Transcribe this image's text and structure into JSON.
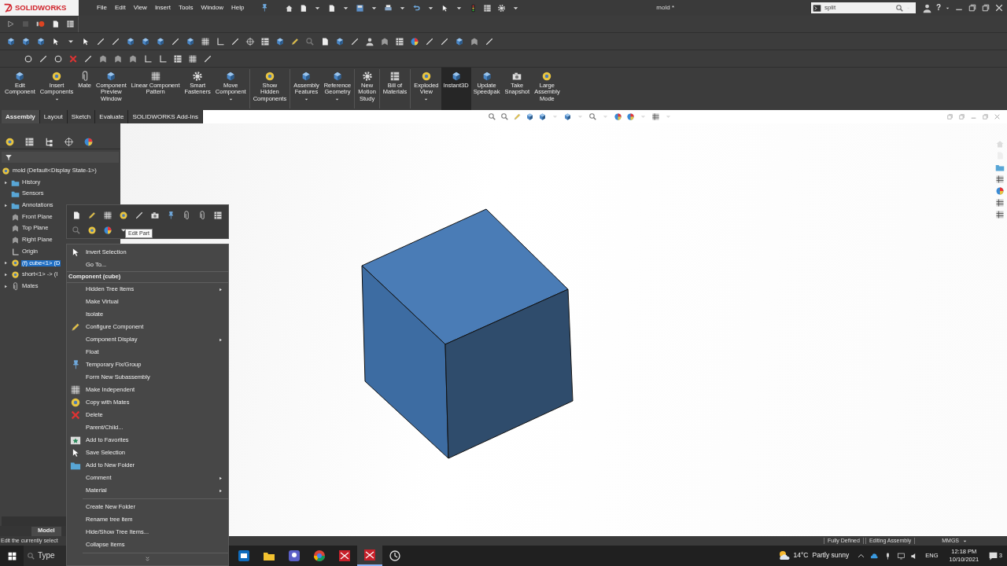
{
  "title_bar": {
    "logo": "SOLIDWORKS",
    "menus": [
      "File",
      "Edit",
      "View",
      "Insert",
      "Tools",
      "Window",
      "Help"
    ],
    "document_title": "mold *",
    "search": {
      "value": "split"
    },
    "help": "?"
  },
  "command_manager": {
    "buttons": [
      {
        "label": "Edit\nComponent",
        "dropdown": false,
        "selected": false
      },
      {
        "label": "Insert\nComponents",
        "dropdown": true,
        "selected": false
      },
      {
        "label": "Mate",
        "dropdown": false,
        "selected": false
      },
      {
        "label": "Component\nPreview\nWindow",
        "dropdown": false,
        "selected": false
      },
      {
        "label": "Linear Component\nPattern",
        "dropdown": false,
        "selected": false
      },
      {
        "label": "Smart\nFasteners",
        "dropdown": false,
        "selected": false
      },
      {
        "label": "Move\nComponent",
        "dropdown": true,
        "selected": false
      },
      {
        "label": "Show\nHidden\nComponents",
        "dropdown": false,
        "selected": false
      },
      {
        "label": "Assembly\nFeatures",
        "dropdown": true,
        "selected": false
      },
      {
        "label": "Reference\nGeometry",
        "dropdown": true,
        "selected": false
      },
      {
        "label": "New\nMotion\nStudy",
        "dropdown": false,
        "selected": false
      },
      {
        "label": "Bill of\nMaterials",
        "dropdown": false,
        "selected": false
      },
      {
        "label": "Exploded\nView",
        "dropdown": true,
        "selected": false
      },
      {
        "label": "Instant3D",
        "dropdown": false,
        "selected": true
      },
      {
        "label": "Update\nSpeedpak",
        "dropdown": false,
        "selected": false
      },
      {
        "label": "Take\nSnapshot",
        "dropdown": false,
        "selected": false
      },
      {
        "label": "Large\nAssembly\nMode",
        "dropdown": false,
        "selected": false
      }
    ],
    "tabs": [
      {
        "label": "Assembly",
        "selected": true
      },
      {
        "label": "Layout",
        "selected": false
      },
      {
        "label": "Sketch",
        "selected": false
      },
      {
        "label": "Evaluate",
        "selected": false
      },
      {
        "label": "SOLIDWORKS Add-Ins",
        "selected": false
      }
    ]
  },
  "feature_tree": {
    "root": "mold  (Default<Display State-1>)",
    "items": [
      {
        "label": "History",
        "kind": "folder",
        "expandable": true,
        "selected": false
      },
      {
        "label": "Sensors",
        "kind": "folder",
        "expandable": false,
        "selected": false
      },
      {
        "label": "Annotations",
        "kind": "folder",
        "expandable": true,
        "selected": false
      },
      {
        "label": "Front Plane",
        "kind": "plane",
        "expandable": false,
        "selected": false
      },
      {
        "label": "Top Plane",
        "kind": "plane",
        "expandable": false,
        "selected": false
      },
      {
        "label": "Right Plane",
        "kind": "plane",
        "expandable": false,
        "selected": false
      },
      {
        "label": "Origin",
        "kind": "origin",
        "expandable": false,
        "selected": false
      },
      {
        "label": "(f) cube<1> (D",
        "kind": "part",
        "expandable": true,
        "selected": true
      },
      {
        "label": "short<1> -> (I",
        "kind": "part",
        "expandable": true,
        "selected": false
      },
      {
        "label": "Mates",
        "kind": "mates",
        "expandable": true,
        "selected": false
      }
    ],
    "tabs": [
      {
        "label": "Model",
        "selected": true
      }
    ]
  },
  "popup_toolbar": {
    "tooltip": "Edit Part"
  },
  "context_menu": {
    "items": [
      {
        "kind": "item",
        "label": "Invert Selection",
        "submenu": false
      },
      {
        "kind": "item",
        "label": "Go To...",
        "submenu": false
      },
      {
        "kind": "header",
        "label": "Component (cube)"
      },
      {
        "kind": "item",
        "label": "Hidden Tree Items",
        "submenu": true
      },
      {
        "kind": "item",
        "label": "Make Virtual",
        "submenu": false
      },
      {
        "kind": "item",
        "label": "Isolate",
        "submenu": false
      },
      {
        "kind": "item",
        "label": "Configure Component",
        "submenu": false
      },
      {
        "kind": "item",
        "label": "Component Display",
        "submenu": true
      },
      {
        "kind": "item",
        "label": "Float",
        "submenu": false
      },
      {
        "kind": "item",
        "label": "Temporary Fix/Group",
        "submenu": false
      },
      {
        "kind": "item",
        "label": "Form New Subassembly",
        "submenu": false
      },
      {
        "kind": "item",
        "label": "Make Independent",
        "submenu": false
      },
      {
        "kind": "item",
        "label": "Copy with Mates",
        "submenu": false
      },
      {
        "kind": "item",
        "label": "Delete",
        "submenu": false
      },
      {
        "kind": "item",
        "label": "Parent/Child...",
        "submenu": false
      },
      {
        "kind": "item",
        "label": "Add to Favorites",
        "submenu": false
      },
      {
        "kind": "item",
        "label": "Save Selection",
        "submenu": false
      },
      {
        "kind": "item",
        "label": "Add to New Folder",
        "submenu": false
      },
      {
        "kind": "item",
        "label": "Comment",
        "submenu": true
      },
      {
        "kind": "item",
        "label": "Material",
        "submenu": true
      },
      {
        "kind": "separator"
      },
      {
        "kind": "item",
        "label": "Create New Folder",
        "submenu": false
      },
      {
        "kind": "item",
        "label": "Rename tree item",
        "submenu": false
      },
      {
        "kind": "item",
        "label": "Hide/Show Tree Items...",
        "submenu": false
      },
      {
        "kind": "item",
        "label": "Collapse Items",
        "submenu": false
      },
      {
        "kind": "more"
      }
    ]
  },
  "status_bar": {
    "message": "Edit the currently select",
    "fields": [
      "Fully Defined",
      "Editing Assembly",
      "MMGS"
    ]
  },
  "taskbar": {
    "search_placeholder": "Type",
    "temperature": "14°C",
    "weather": "Partly sunny",
    "language": "ENG",
    "time": "12:18 PM",
    "date": "10/10/2021",
    "notifications": "3"
  }
}
